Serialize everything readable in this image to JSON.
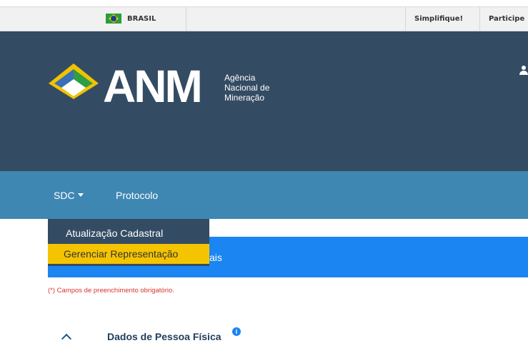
{
  "govbar": {
    "country": "BRASIL",
    "links": [
      "Simplifique!",
      "Participe"
    ]
  },
  "header": {
    "logo": "ANM",
    "subtitle_lines": [
      "Agência",
      "Nacional de",
      "Mineração"
    ]
  },
  "nav": {
    "items": [
      {
        "label": "SDC",
        "has_dropdown": true
      },
      {
        "label": "Protocolo",
        "has_dropdown": false
      }
    ]
  },
  "dropdown": {
    "items": [
      {
        "label": "Atualização Cadastral",
        "highlighted": false
      },
      {
        "label": "Gerenciar Representação",
        "highlighted": true
      }
    ]
  },
  "banner": {
    "partial_text": "ais"
  },
  "form": {
    "required_note": "(*) Campos de preenchimento obrigatório.",
    "section_title": "Dados de Pessoa Física",
    "info_icon": "i"
  },
  "colors": {
    "header_bg": "#344c63",
    "nav_bg": "#3e87b2",
    "banner_bg": "#1b85f1",
    "highlight": "#f5c400",
    "required_text": "#d9342b"
  }
}
